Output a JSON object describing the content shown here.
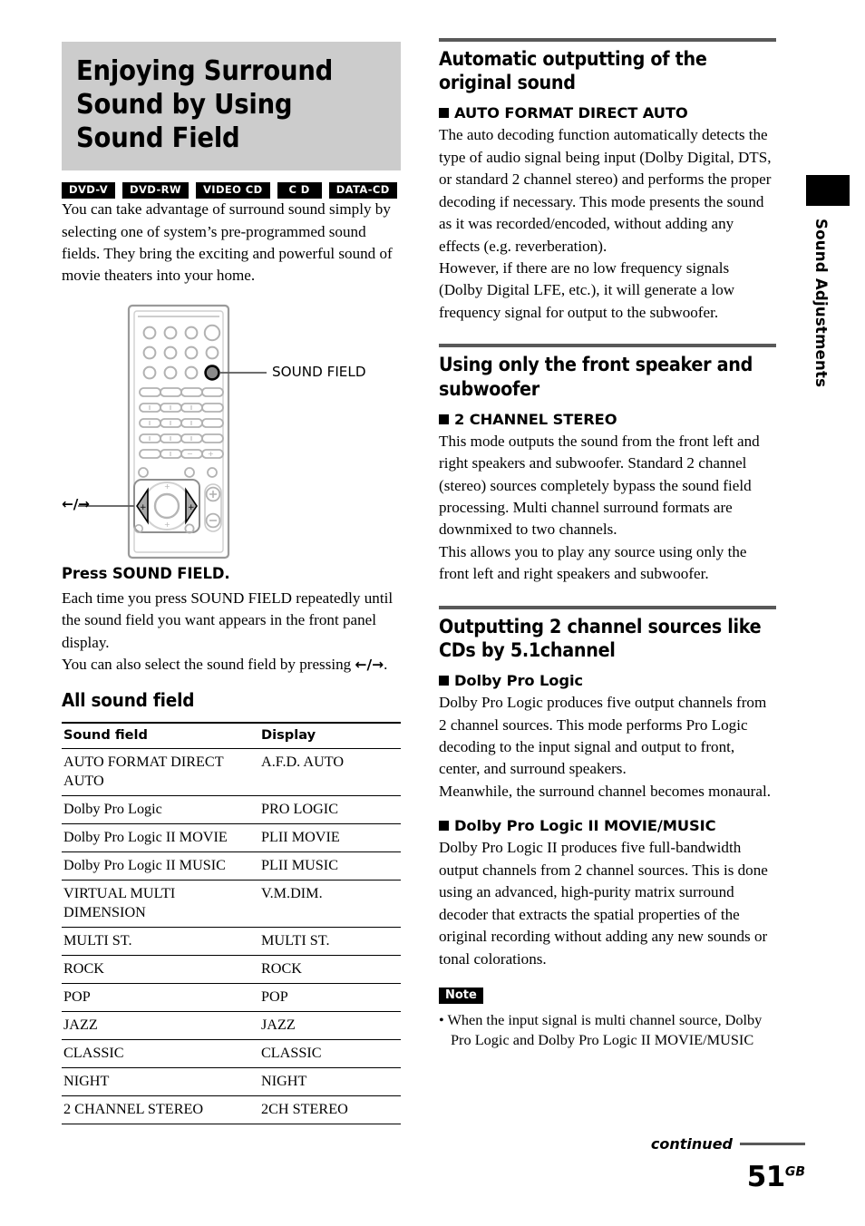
{
  "page": {
    "number": "51",
    "region_code": "GB",
    "continued_label": "continued",
    "side_tab_label": "Sound Adjustments"
  },
  "left": {
    "title": "Enjoying Surround Sound by Using Sound Field",
    "badges": [
      {
        "label": "DVD-V",
        "name": "badge-dvd-v"
      },
      {
        "label": "DVD-RW",
        "name": "badge-dvd-rw"
      },
      {
        "label": "VIDEO CD",
        "name": "badge-video-cd"
      },
      {
        "label": "C D",
        "name": "badge-cd"
      },
      {
        "label": "DATA-CD",
        "name": "badge-data-cd"
      }
    ],
    "intro": "You can take advantage of surround sound simply by selecting one of system’s pre-programmed sound fields. They bring the exciting and powerful sound of movie theaters into your home.",
    "figure": {
      "callout_sound_field": "SOUND FIELD",
      "callout_arrows": "←/→"
    },
    "instruction_heading": "Press SOUND FIELD.",
    "instruction_body_1": "Each time you press SOUND FIELD repeatedly until the sound field you want appears in the front panel display.",
    "instruction_body_2_prefix": "You can also select the sound field by pressing ",
    "instruction_body_2_arrows": "←/→",
    "instruction_body_2_suffix": ".",
    "table_heading": "All sound field",
    "table": {
      "columns": [
        "Sound field",
        "Display"
      ],
      "rows": [
        [
          "AUTO FORMAT DIRECT AUTO",
          "A.F.D. AUTO"
        ],
        [
          "Dolby Pro Logic",
          "PRO LOGIC"
        ],
        [
          "Dolby Pro Logic II MOVIE",
          "PLII MOVIE"
        ],
        [
          "Dolby Pro Logic II MUSIC",
          "PLII MUSIC"
        ],
        [
          "VIRTUAL MULTI DIMENSION",
          "V.M.DIM."
        ],
        [
          "MULTI ST.",
          "MULTI ST."
        ],
        [
          "ROCK",
          "ROCK"
        ],
        [
          "POP",
          "POP"
        ],
        [
          "JAZZ",
          "JAZZ"
        ],
        [
          "CLASSIC",
          "CLASSIC"
        ],
        [
          "NIGHT",
          "NIGHT"
        ],
        [
          "2 CHANNEL STEREO",
          "2CH STEREO"
        ]
      ]
    }
  },
  "right": {
    "section1": {
      "heading": "Automatic outputting of the original sound",
      "item_heading": "AUTO FORMAT DIRECT AUTO",
      "paragraph_1": "The auto decoding function automatically detects the type of audio signal being input (Dolby Digital, DTS, or standard 2 channel stereo) and performs the proper decoding if necessary. This mode presents the sound as it was recorded/encoded, without adding any effects (e.g. reverberation).",
      "paragraph_2": "However, if there are no low frequency signals (Dolby Digital LFE, etc.), it will generate a low frequency signal for output to the subwoofer."
    },
    "section2": {
      "heading": "Using only the front speaker and subwoofer",
      "item_heading": "2 CHANNEL STEREO",
      "paragraph_1": "This mode outputs the sound from the front left and right speakers and subwoofer. Standard 2 channel (stereo) sources completely bypass the sound field processing. Multi channel surround formats are downmixed to two channels.",
      "paragraph_2": "This allows you to play any source using only the front left and right speakers and subwoofer."
    },
    "section3": {
      "heading": "Outputting 2 channel sources like CDs by 5.1channel",
      "item1_heading": "Dolby Pro Logic",
      "item1_paragraph_1": "Dolby Pro Logic produces five output channels from 2 channel sources. This mode performs Pro Logic decoding to the input signal and output to front, center, and surround speakers.",
      "item1_paragraph_2": "Meanwhile, the surround channel becomes monaural.",
      "item2_heading": "Dolby Pro Logic II MOVIE/MUSIC",
      "item2_paragraph": "Dolby Pro Logic II produces five full-bandwidth output channels from 2 channel sources. This is done using an advanced, high-purity matrix surround decoder that extracts the spatial properties of the original recording without adding any new sounds or tonal colorations."
    },
    "note": {
      "label": "Note",
      "items": [
        "When the input signal is multi channel source, Dolby Pro Logic and Dolby Pro Logic II MOVIE/MUSIC"
      ]
    }
  }
}
